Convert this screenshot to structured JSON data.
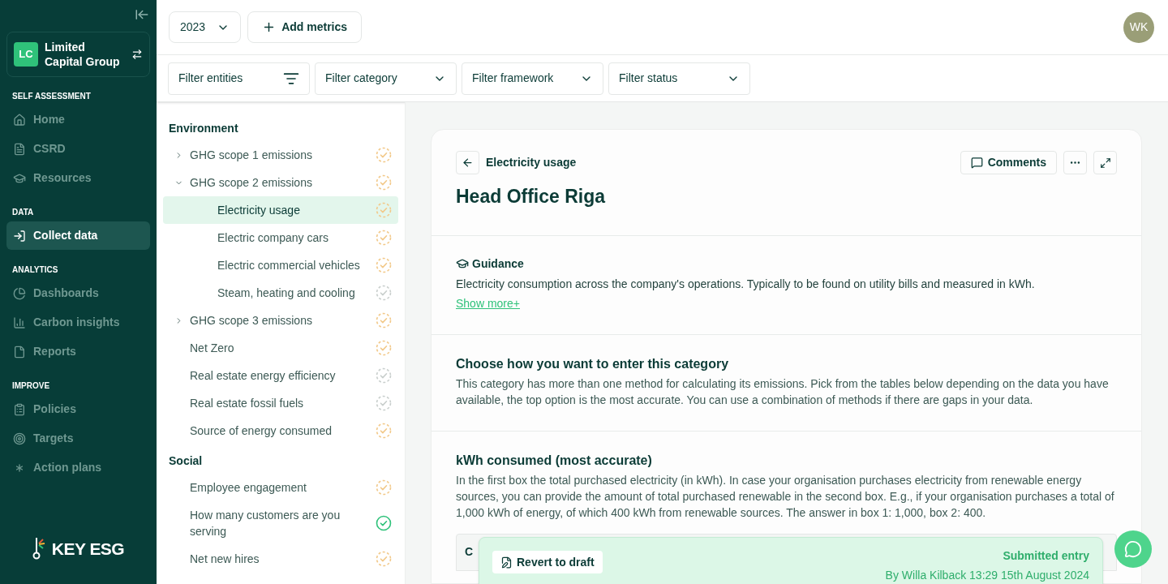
{
  "org": {
    "initials": "LC",
    "name": "Limited Capital Group"
  },
  "nav_sections": [
    {
      "label": "SELF ASSESSMENT",
      "items": [
        {
          "label": "Home",
          "selected": false
        },
        {
          "label": "CSRD",
          "selected": false
        },
        {
          "label": "Resources",
          "selected": false
        }
      ]
    },
    {
      "label": "DATA",
      "items": [
        {
          "label": "Collect data",
          "selected": true
        }
      ]
    },
    {
      "label": "ANALYTICS",
      "items": [
        {
          "label": "Dashboards",
          "selected": false
        },
        {
          "label": "Carbon insights",
          "selected": false
        },
        {
          "label": "Reports",
          "selected": false
        }
      ]
    },
    {
      "label": "IMPROVE",
      "items": [
        {
          "label": "Policies",
          "selected": false
        },
        {
          "label": "Targets",
          "selected": false
        },
        {
          "label": "Action plans",
          "selected": false
        }
      ]
    }
  ],
  "brand": "KEY ESG",
  "toolbar": {
    "year": "2023",
    "add_button": "Add metrics",
    "avatar": "WK"
  },
  "filters": [
    {
      "label": "Filter entities",
      "kind": "filter"
    },
    {
      "label": "Filter category",
      "kind": "dropdown"
    },
    {
      "label": "Filter framework",
      "kind": "dropdown"
    },
    {
      "label": "Filter status",
      "kind": "dropdown"
    }
  ],
  "metric_groups": [
    {
      "title": "Environment",
      "items": [
        {
          "label": "GHG scope 1 emissions",
          "kind": "pending",
          "expanded": false,
          "selected": false
        },
        {
          "label": "GHG scope 2 emissions",
          "kind": "pending",
          "expanded": true,
          "selected": false,
          "children": [
            {
              "label": "Electricity usage",
              "kind": "pending",
              "selected": true
            },
            {
              "label": "Electric company cars",
              "kind": "pending",
              "selected": false
            },
            {
              "label": "Electric commercial vehicles",
              "kind": "pending",
              "selected": false
            },
            {
              "label": "Steam, heating and cooling",
              "kind": "empty",
              "selected": false
            }
          ]
        },
        {
          "label": "GHG scope 3 emissions",
          "kind": "pending",
          "expanded": false,
          "selected": false
        },
        {
          "label": "Net Zero",
          "kind": "pending",
          "selected": false
        },
        {
          "label": "Real estate energy efficiency",
          "kind": "empty",
          "selected": false
        },
        {
          "label": "Real estate fossil fuels",
          "kind": "empty",
          "selected": false
        },
        {
          "label": "Source of energy consumed",
          "kind": "pending",
          "selected": false
        }
      ]
    },
    {
      "title": "Social",
      "items": [
        {
          "label": "Employee engagement",
          "kind": "pending",
          "selected": false
        },
        {
          "label": "How many customers are you serving",
          "kind": "done",
          "selected": false
        },
        {
          "label": "Net new hires",
          "kind": "pending",
          "selected": false
        }
      ]
    }
  ],
  "detail": {
    "breadcrumb": "Electricity usage",
    "title": "Head Office Riga",
    "comments_button": "Comments",
    "guidance": {
      "title": "Guidance",
      "text": "Electricity consumption across the company's operations. Typically to be found on utility bills and measured in kWh.",
      "link": "Show more+"
    },
    "method": {
      "title": "Choose how you want to enter this category",
      "text": "This category has more than one method for calculating its emissions. Pick from the tables below depending on the data you have available, the top option is the most accurate. You can use a combination of methods if there are gaps in your data."
    },
    "kwh": {
      "title": "kWh consumed (most accurate)",
      "text": "In the first box the total purchased electricity (in kWh). In case your organisation purchases electricity from renewable energy sources, you can provide the amount of total purchased renewable in the second box. E.g., if your organisation purchases a total of 1,000 kWh of energy, of which 400 kWh from renewable sources. The answer in box 1: 1,000, box 2: 400.",
      "table_columns": [
        "C"
      ]
    }
  },
  "submission": {
    "revert_button": "Revert to draft",
    "status": "Submitted entry",
    "byline": "By Willa Kilback 13:29 15th August 2024"
  }
}
